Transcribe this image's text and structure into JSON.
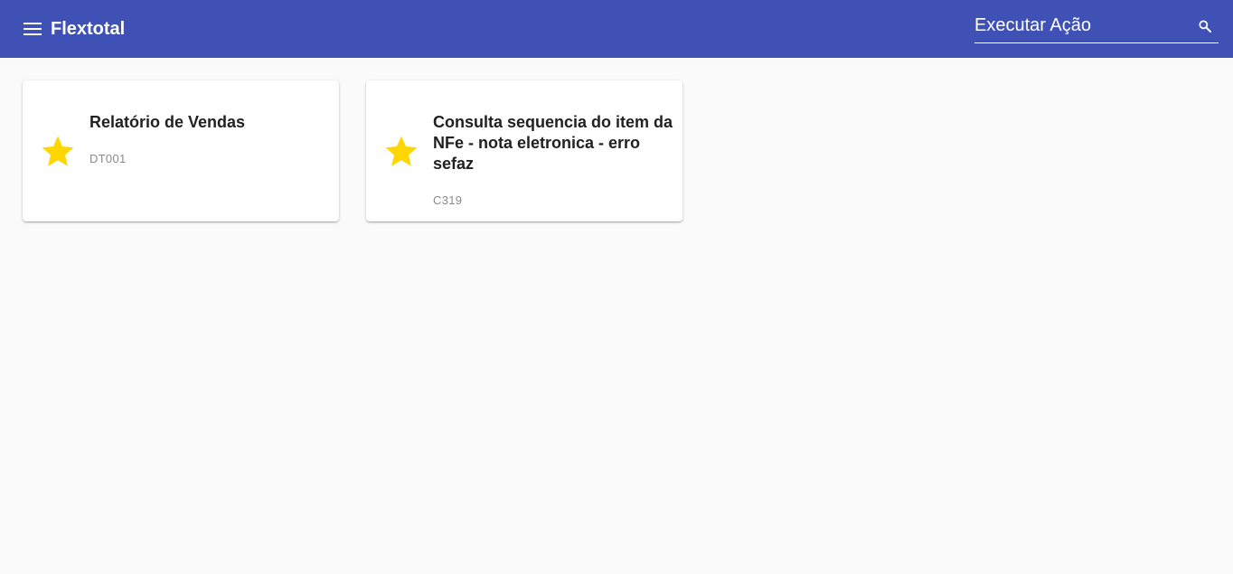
{
  "header": {
    "title": "Flextotal",
    "menu_icon": "menu-icon",
    "background_color": "#3f51b5",
    "search": {
      "placeholder": "Executar Ação",
      "value": "",
      "icon": "search-icon"
    }
  },
  "cards": [
    {
      "title": "Relatório de Vendas",
      "code": "DT001",
      "icon": "star-icon",
      "icon_color": "#ffd600"
    },
    {
      "title": "Consulta sequencia do item da NFe - nota eletronica - erro sefaz",
      "code": "C319",
      "icon": "star-icon",
      "icon_color": "#ffd600"
    }
  ]
}
